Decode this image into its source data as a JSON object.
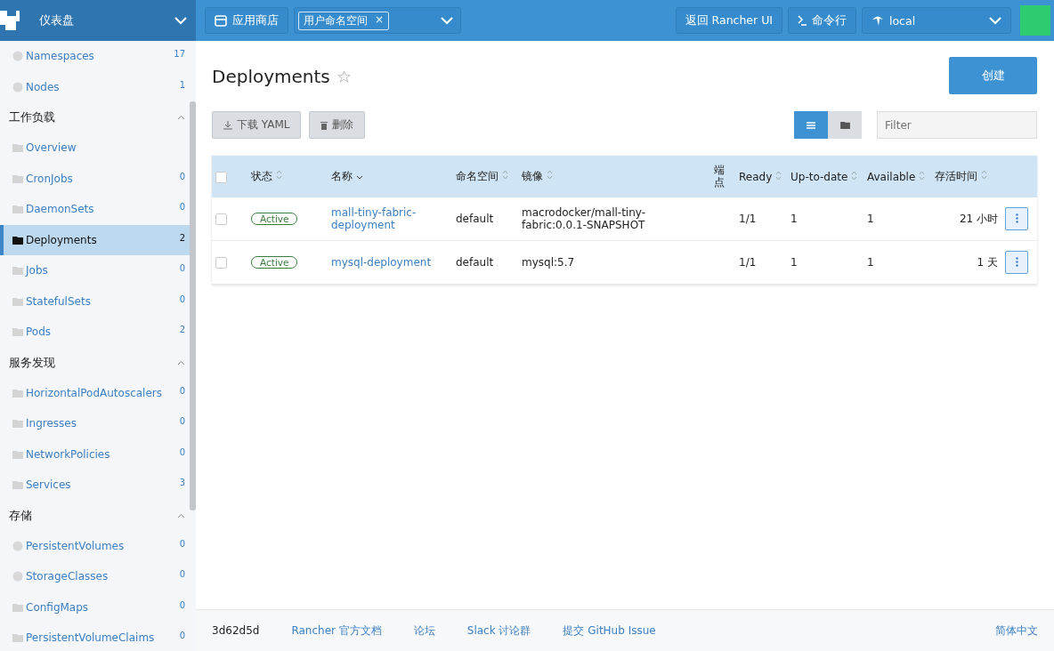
{
  "header": {
    "title": "仪表盘",
    "app_store": "应用商店",
    "namespace_tag": "用户命名空间",
    "tag_close": "×",
    "back_button": "返回 Rancher UI",
    "shell_button": "命令行",
    "cluster": "local"
  },
  "sidebar": {
    "items": [
      {
        "label": "Namespaces",
        "count": "17",
        "kind": "circle",
        "selected": false
      },
      {
        "label": "Nodes",
        "count": "1",
        "kind": "circle",
        "selected": false
      }
    ],
    "groups": [
      {
        "title": "工作负载",
        "expanded": true,
        "items": [
          {
            "label": "Overview",
            "kind": "folder",
            "selected": false
          },
          {
            "label": "CronJobs",
            "count": "0",
            "kind": "folder",
            "selected": false
          },
          {
            "label": "DaemonSets",
            "count": "0",
            "kind": "folder",
            "selected": false
          },
          {
            "label": "Deployments",
            "count": "2",
            "kind": "folder",
            "selected": true
          },
          {
            "label": "Jobs",
            "count": "0",
            "kind": "folder",
            "selected": false
          },
          {
            "label": "StatefulSets",
            "count": "0",
            "kind": "folder",
            "selected": false
          },
          {
            "label": "Pods",
            "count": "2",
            "kind": "folder",
            "selected": false
          }
        ]
      },
      {
        "title": "服务发现",
        "expanded": true,
        "items": [
          {
            "label": "HorizontalPodAutoscalers",
            "count": "0",
            "kind": "folder",
            "selected": false
          },
          {
            "label": "Ingresses",
            "count": "0",
            "kind": "folder",
            "selected": false
          },
          {
            "label": "NetworkPolicies",
            "count": "0",
            "kind": "folder",
            "selected": false
          },
          {
            "label": "Services",
            "count": "3",
            "kind": "folder",
            "selected": false
          }
        ]
      },
      {
        "title": "存储",
        "expanded": true,
        "items": [
          {
            "label": "PersistentVolumes",
            "count": "0",
            "kind": "circle",
            "selected": false
          },
          {
            "label": "StorageClasses",
            "count": "0",
            "kind": "circle",
            "selected": false
          },
          {
            "label": "ConfigMaps",
            "count": "0",
            "kind": "folder",
            "selected": false
          },
          {
            "label": "PersistentVolumeClaims",
            "count": "0",
            "kind": "folder",
            "selected": false
          }
        ]
      }
    ]
  },
  "page": {
    "title": "Deployments",
    "create_button": "创建",
    "download_button": "下载 YAML",
    "delete_button": "删除",
    "filter_placeholder": "Filter",
    "view_toggle": [
      {
        "kind": "list",
        "selected": true
      },
      {
        "kind": "folder",
        "selected": false
      }
    ]
  },
  "table": {
    "select_all_checked": false,
    "columns": [
      "状态",
      "名称",
      "命名空间",
      "镜像",
      "端点",
      "Ready",
      "Up-to-date",
      "Available",
      "存活时间"
    ],
    "rows": [
      {
        "checked": false,
        "status": "Active",
        "name": "mall-tiny-fabric-deployment",
        "namespace": "default",
        "image": "macrodocker/mall-tiny-fabric:0.0.1-SNAPSHOT",
        "ready": "1/1",
        "up_to_date": "1",
        "available": "1",
        "age": "21 小时"
      },
      {
        "checked": false,
        "status": "Active",
        "name": "mysql-deployment",
        "namespace": "default",
        "image": "mysql:5.7",
        "ready": "1/1",
        "up_to_date": "1",
        "available": "1",
        "age": "1 天"
      }
    ]
  },
  "footer": {
    "version": "3d62d5d",
    "links": [
      "Rancher 官方文档",
      "论坛",
      "Slack 讨论群",
      "提交 GitHub Issue"
    ],
    "language": "简体中文"
  }
}
